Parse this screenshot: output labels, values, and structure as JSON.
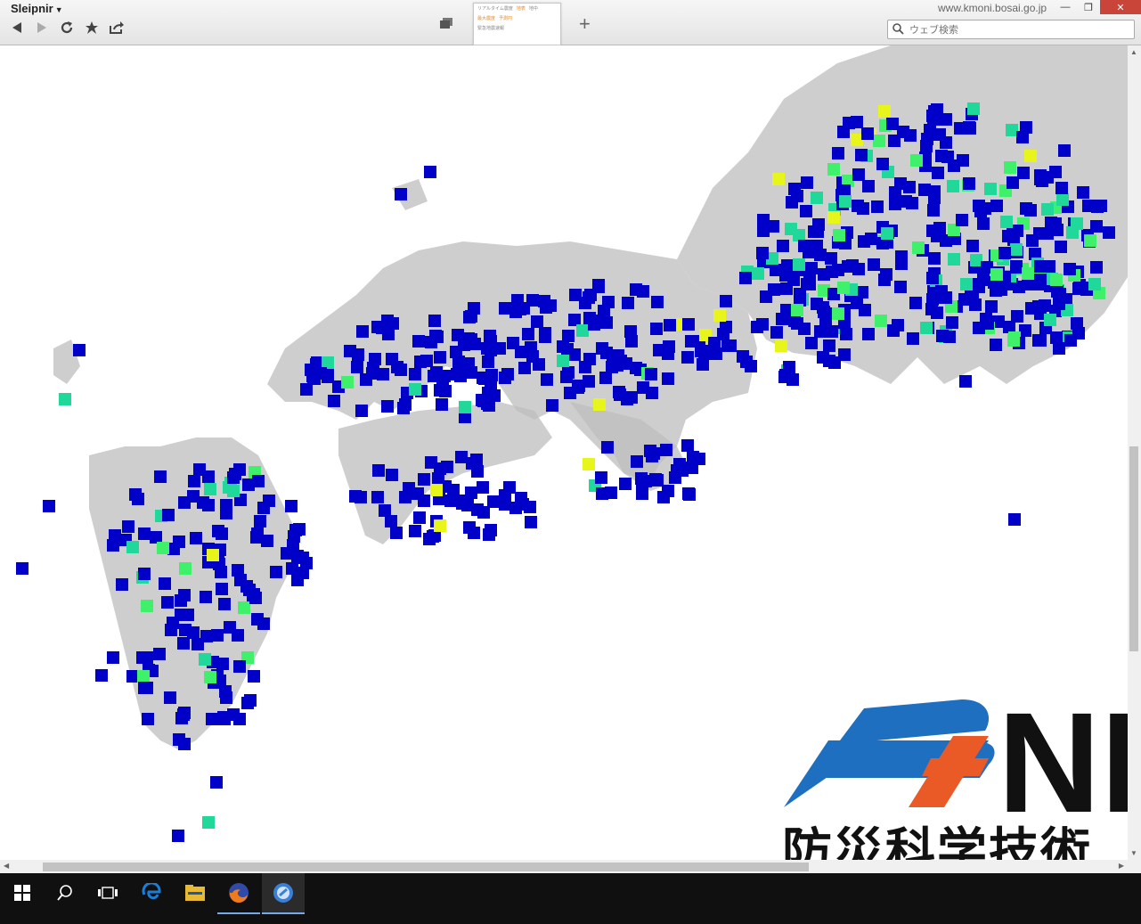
{
  "browser": {
    "app_name": "Sleipnir",
    "domain": "www.kmoni.bosai.go.jp",
    "search_placeholder": "ウェブ検索",
    "tab_thumb_lines": [
      "リアルタイム震度",
      "地表",
      "地中",
      "最大震度",
      "予測円",
      "緊急地震速報"
    ],
    "icons": [
      "back-icon",
      "forward-icon",
      "reload-icon",
      "star-icon",
      "share-icon",
      "tabs-icon",
      "new-tab-icon",
      "search-icon"
    ],
    "window": {
      "minimize": "—",
      "restore": "❐",
      "close": "✕"
    }
  },
  "map": {
    "colors": {
      "station_low": "#0000c8",
      "station_mid": "#21d89b",
      "station_mid2": "#3ff06a",
      "station_high": "#e8f51a",
      "terrain": "#bdbdbd"
    }
  },
  "logo": {
    "letters": "NI",
    "caption": "防災科学技術"
  },
  "taskbar": {
    "icons": [
      "start-icon",
      "search-icon",
      "task-view-icon",
      "edge-icon",
      "file-explorer-icon",
      "firefox-icon",
      "sleipnir-icon"
    ],
    "accent": "#76a9e8"
  }
}
